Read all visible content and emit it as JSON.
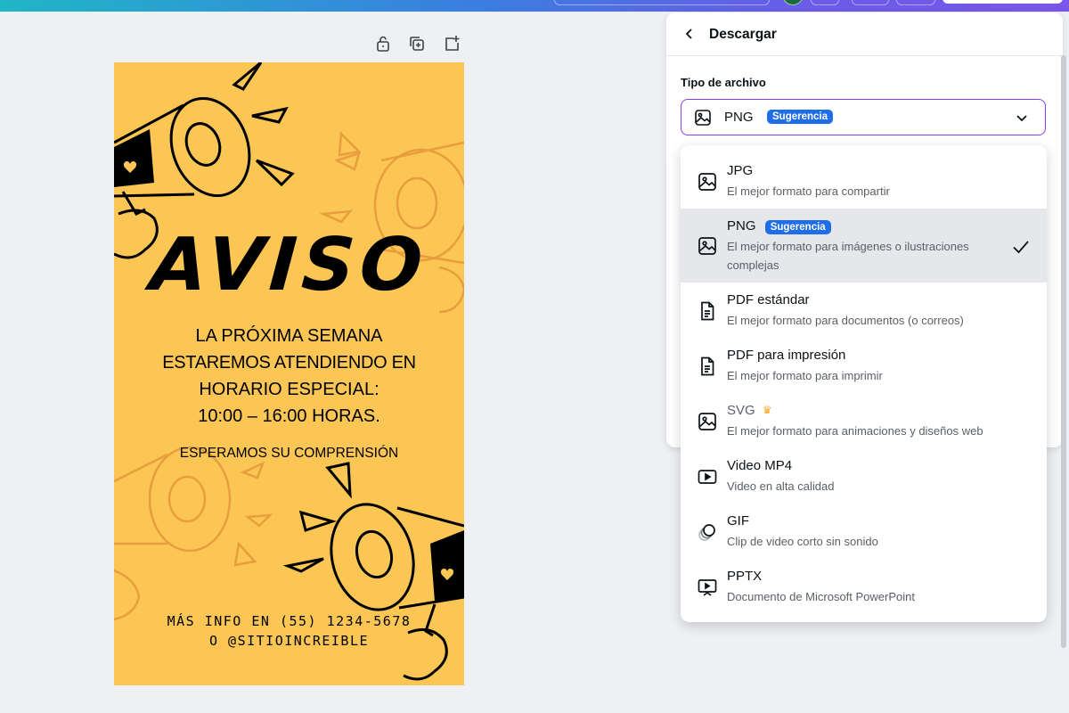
{
  "colors": {
    "accent": "#8b3dff",
    "badge": "#1f6ee8",
    "poster_background": "#fbc654",
    "selected_row": "#e5e7eb",
    "crown": "#f5a623"
  },
  "canvas_toolbar": {
    "icons": [
      "lock-icon",
      "duplicate-page-icon",
      "add-page-icon"
    ]
  },
  "poster": {
    "headline": "AVISO",
    "message_lines": [
      "LA PRÓXIMA SEMANA",
      "ESTAREMOS ATENDIENDO EN",
      "HORARIO ESPECIAL:",
      "10:00 – 16:00 HORAS."
    ],
    "subtext": "ESPERAMOS SU COMPRENSIÓN",
    "info_lines": [
      "MÁS INFO EN (55) 1234-5678",
      "O @SITIOINCREIBLE"
    ]
  },
  "download_panel": {
    "title": "Descargar",
    "file_type_label": "Tipo de archivo",
    "selected_value": "PNG",
    "selected_badge": "Sugerencia"
  },
  "file_types": [
    {
      "name": "JPG",
      "desc": "El mejor formato para compartir",
      "icon": "image-icon"
    },
    {
      "name": "PNG",
      "badge": "Sugerencia",
      "desc": "El mejor formato para imágenes o ilustraciones complejas",
      "icon": "image-icon",
      "selected": true
    },
    {
      "name": "PDF estándar",
      "desc": "El mejor formato para documentos (o correos)",
      "icon": "document-icon"
    },
    {
      "name": "PDF para impresión",
      "desc": "El mejor formato para imprimir",
      "icon": "document-icon"
    },
    {
      "name": "SVG",
      "desc": "El mejor formato para animaciones y diseños web",
      "icon": "image-icon",
      "premium": true
    },
    {
      "name": "Video MP4",
      "desc": "Video en alta calidad",
      "icon": "video-icon"
    },
    {
      "name": "GIF",
      "desc": "Clip de video corto sin sonido",
      "icon": "gif-icon"
    },
    {
      "name": "PPTX",
      "desc": "Documento de Microsoft PowerPoint",
      "icon": "presentation-icon"
    }
  ]
}
